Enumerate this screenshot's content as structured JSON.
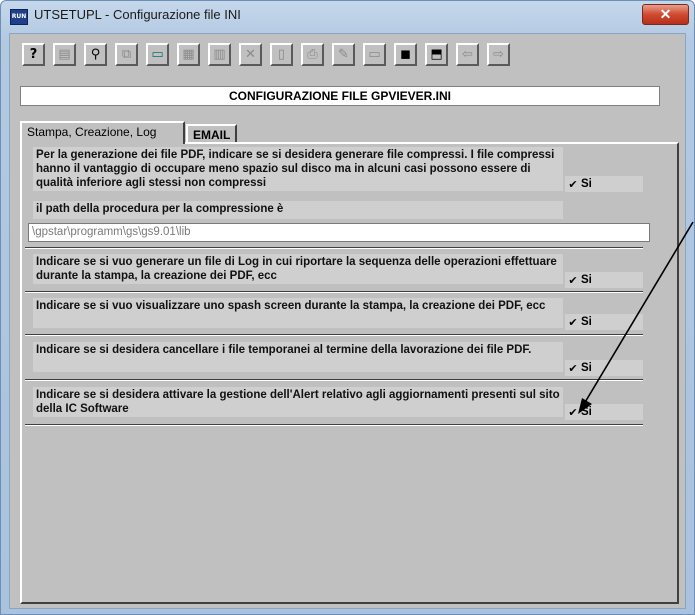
{
  "window": {
    "title": "UTSETUPL - Configurazione file INI",
    "app_icon_text": "RUN",
    "close_glyph": "✕"
  },
  "toolbar": {
    "buttons": [
      {
        "name": "help-icon",
        "glyph": "?",
        "enabled": true
      },
      {
        "name": "properties-icon",
        "glyph": "▤",
        "enabled": false
      },
      {
        "name": "find-icon",
        "glyph": "⚲",
        "enabled": true
      },
      {
        "name": "copy-icon",
        "glyph": "⧉",
        "enabled": false
      },
      {
        "name": "monitor-icon",
        "glyph": "▭",
        "enabled": true
      },
      {
        "name": "paste-icon",
        "glyph": "▦",
        "enabled": false
      },
      {
        "name": "grid-icon",
        "glyph": "▥",
        "enabled": false
      },
      {
        "name": "delete-icon",
        "glyph": "✕",
        "enabled": false
      },
      {
        "name": "preview-icon",
        "glyph": "▯",
        "enabled": false
      },
      {
        "name": "print-icon",
        "glyph": "⎙",
        "enabled": false
      },
      {
        "name": "edit-icon",
        "glyph": "✎",
        "enabled": false
      },
      {
        "name": "form-icon",
        "glyph": "▭",
        "enabled": false
      },
      {
        "name": "save-icon",
        "glyph": "▪",
        "enabled": true
      },
      {
        "name": "open-folder-icon",
        "glyph": "⬒",
        "enabled": true
      },
      {
        "name": "back-icon",
        "glyph": "⇦",
        "enabled": false
      },
      {
        "name": "forward-icon",
        "glyph": "⇨",
        "enabled": false
      }
    ]
  },
  "header": {
    "title": "CONFIGURAZIONE FILE GPVIEVER.INI"
  },
  "tabs": [
    {
      "label": "Stampa, Creazione, Log",
      "active": true
    },
    {
      "label": "EMAIL",
      "active": false
    }
  ],
  "settings": {
    "compress": {
      "text": "Per la generazione dei file PDF, indicare se si desidera generare file compressi. I file compressi hanno il vantaggio di occupare meno spazio sul disco ma in alcuni casi possono essere di qualità inferiore agli stessi non compressi",
      "check_label": "Si",
      "checked": true
    },
    "path": {
      "label": "il path della procedura per la compressione è",
      "value": "\\gpstar\\programm\\gs\\gs9.01\\lib"
    },
    "log": {
      "text": "Indicare se si vuo generare un file di Log in cui riportare la sequenza delle operazioni effettuare durante la stampa, la creazione dei PDF, ecc",
      "check_label": "Si",
      "checked": true
    },
    "splash": {
      "text": "Indicare se si vuo visualizzare uno spash screen durante la stampa, la creazione dei PDF, ecc",
      "check_label": "Si",
      "checked": true
    },
    "temp": {
      "text": "Indicare se si desidera cancellare i file temporanei al termine della lavorazione dei file PDF.",
      "check_label": "Si",
      "checked": true
    },
    "alert": {
      "text": "Indicare se si desidera attivare la gestione dell'Alert relativo agli aggiornamenti presenti sul sito della IC Software",
      "check_label": "Si",
      "checked": true
    }
  },
  "colors": {
    "titlebar": "#b2c9e2",
    "face": "#c0c0c0",
    "close": "#cf4a30",
    "arrow": "#000000"
  }
}
